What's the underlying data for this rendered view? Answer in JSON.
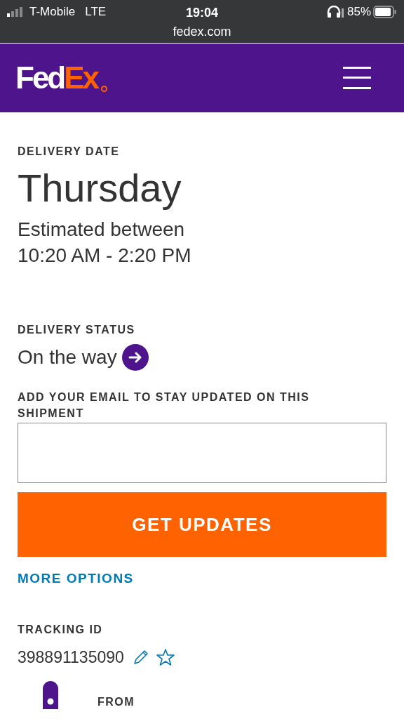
{
  "status_bar": {
    "carrier": "T-Mobile",
    "network": "LTE",
    "time": "19:04",
    "url": "fedex.com",
    "battery": "85%"
  },
  "header": {
    "logo": {
      "part_1": "Fed",
      "part_2": "Ex"
    }
  },
  "delivery_date": {
    "label": "DELIVERY DATE",
    "day": "Thursday",
    "estimate_line_1": "Estimated between",
    "estimate_line_2": "10:20 AM - 2:20 PM"
  },
  "delivery_status": {
    "label": "DELIVERY STATUS",
    "value": "On the way"
  },
  "email": {
    "label": "ADD YOUR EMAIL TO STAY UPDATED ON THIS SHIPMENT",
    "button": "GET UPDATES",
    "link": "MORE OPTIONS"
  },
  "tracking": {
    "label": "TRACKING ID",
    "number": "398891135090"
  },
  "route": {
    "from_label": "FROM"
  }
}
